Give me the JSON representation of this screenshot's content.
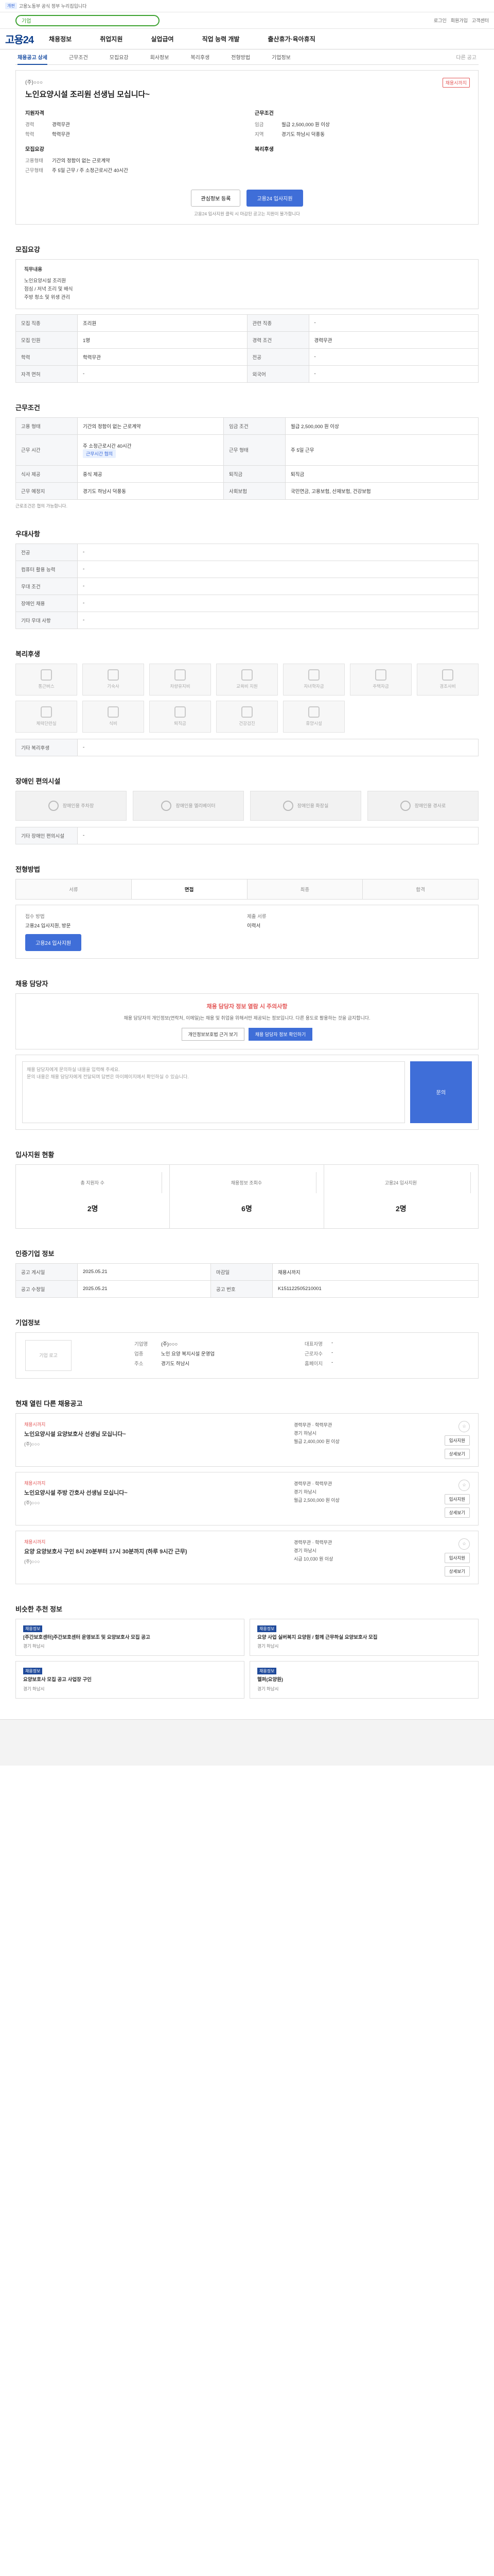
{
  "topbar": {
    "badge": "개편",
    "text": "고용노동부 공식 정부 누리집입니다"
  },
  "search": {
    "placeholder": "기업"
  },
  "util": [
    "로그인",
    "회원가입",
    "고객센터"
  ],
  "gnb": {
    "logo": "고용24",
    "menu": [
      "채용정보",
      "취업지원",
      "실업급여",
      "직업 능력 개발",
      "출산휴가·육아휴직"
    ]
  },
  "tabs": {
    "items": [
      "채용공고 상세",
      "근무조건",
      "모집요강",
      "회사정보",
      "복리후생",
      "전형방법",
      "기업정보"
    ],
    "right": "다른 공고"
  },
  "job": {
    "company": "(주)○○○",
    "title": "노인요양시설 조리원 선생님 모십니다~",
    "dday": "채용시까지",
    "left_title": "지원자격",
    "left": [
      {
        "k": "경력",
        "v": "경력무관"
      },
      {
        "k": "학력",
        "v": "학력무관"
      }
    ],
    "right_title": "근무조건",
    "right": [
      {
        "k": "임금",
        "v": "월급 2,500,000 원 이상"
      },
      {
        "k": "지역",
        "v": "경기도 하남시 덕풍동"
      }
    ],
    "left2_title": "모집요강",
    "left2": [
      {
        "k": "고용형태",
        "v": "기간의 정함이 없는 근로계약"
      },
      {
        "k": "근무형태",
        "v": "주 5일 근무 / 주 소정근로시간 40시간"
      }
    ],
    "right2_title": "복리후생",
    "right2": [
      {
        "k": "",
        "v": ""
      }
    ],
    "btn_scrap": "관심정보 등록",
    "btn_apply": "고용24 입사지원",
    "notice": "고용24 입사지원 클릭 시 마감된 공고는 지원이 불가합니다"
  },
  "sections": {
    "recruit": "모집요강",
    "work": "근무조건",
    "pref": "우대사항",
    "benefit": "복리후생",
    "disabled": "장애인 편의시설",
    "process": "전형방법",
    "contact": "채용 담당자",
    "status": "입사지원 현황",
    "info": "인증기업 정보",
    "company": "기업정보",
    "similar": "현재 열린 다른 채용공고",
    "recommend": "비슷한 추천 정보"
  },
  "recruit": {
    "duty_label": "직무내용",
    "duty_text": "노인요양시설 조리원\n점심 / 저녁 조리 및 배식\n주방 청소 및 위생 관리",
    "rows": [
      [
        "모집 직종",
        "조리원",
        "관련 직종",
        "-"
      ],
      [
        "모집 인원",
        "1명",
        "경력 조건",
        "경력무관"
      ],
      [
        "학력",
        "학력무관",
        "전공",
        "-"
      ],
      [
        "자격 면허",
        "-",
        "외국어",
        "-"
      ]
    ]
  },
  "work": {
    "rows": [
      [
        "고용 형태",
        "기간의 정함이 없는 근로계약",
        "임금 조건",
        "월급 2,500,000 원 이상"
      ],
      [
        "근무 시간",
        "주 소정근로시간 40시간",
        "근무 형태",
        "주 5일 근무"
      ],
      [
        "식사 제공",
        "중식 제공",
        "퇴직금",
        "퇴직금"
      ],
      [
        "근무 예정지",
        "경기도 하남시 덕풍동",
        "사회보험",
        "국민연금, 고용보험, 산재보험, 건강보험"
      ]
    ],
    "tag": "근무시간 협의",
    "note": "근로조건은 협의 가능합니다."
  },
  "pref": {
    "rows": [
      [
        "전공",
        "-"
      ],
      [
        "컴퓨터 활용 능력",
        "-"
      ],
      [
        "우대 조건",
        "-"
      ],
      [
        "장애인 채용",
        "-"
      ],
      [
        "기타 우대 사항",
        "-"
      ]
    ]
  },
  "benefit": {
    "label": "기타 복리후생",
    "items": [
      "통근버스",
      "기숙사",
      "차량유지비",
      "교육비 지원",
      "자녀학자금",
      "주택자금",
      "경조사비",
      "체력단련실",
      "식비",
      "퇴직금",
      "건강검진",
      "휴양시설"
    ]
  },
  "disabled": {
    "items": [
      "장애인용 주차장",
      "장애인용 엘리베이터",
      "장애인용 화장실",
      "장애인용 경사로"
    ],
    "label": "기타 장애인 편의시설"
  },
  "process": {
    "steps": [
      "서류",
      "면접",
      "최종",
      "합격"
    ],
    "how_label": "접수 방법",
    "how_value": "고용24 입사지원, 방문",
    "doc_label": "제출 서류",
    "doc_value": "이력서",
    "apply": "고용24 입사지원"
  },
  "contact": {
    "warn_title": "채용 담당자 정보 열람 시 주의사항",
    "warn_desc": "채용 담당자의 개인정보(연락처, 이메일)는 채용 및 취업을 위해서만 제공되는 정보입니다. 다른 용도로 활용하는 것을 금지합니다.",
    "btn1": "개인정보보호법 근거 보기",
    "btn2": "채용 담당자 정보 확인하기",
    "inq_placeholder": "채용 담당자에게 문의하실 내용을 입력해 주세요.\n문의 내용은 채용 담당자에게 전달되며 답변은 마이페이지에서 확인하실 수 있습니다.",
    "send": "문의"
  },
  "status": {
    "stats": [
      {
        "lab": "총 지원자 수",
        "num": "2명"
      },
      {
        "lab": "채용정보 조회수",
        "num": "6명"
      },
      {
        "lab": "고용24 입사지원",
        "num": "2명"
      }
    ]
  },
  "info": {
    "rows": [
      [
        "공고 게시일",
        "2025.05.21",
        "마감일",
        "채용시까지"
      ],
      [
        "공고 수정일",
        "2025.05.21",
        "공고 번호",
        "K151122505210001"
      ]
    ]
  },
  "company": {
    "logo": "기업 로고",
    "kv": [
      {
        "k": "기업명",
        "v": "(주)○○○"
      },
      {
        "k": "업종",
        "v": "노인 요양 복지시설 운영업"
      },
      {
        "k": "주소",
        "v": "경기도 하남시"
      }
    ],
    "kv2": [
      {
        "k": "대표자명",
        "v": "-"
      },
      {
        "k": "근로자수",
        "v": "-"
      },
      {
        "k": "홈페이지",
        "v": "-"
      }
    ]
  },
  "similar": [
    {
      "dday": "채용시까지",
      "title": "노인요양시설 요양보호사 선생님 모십니다~",
      "co": "(주)○○○",
      "meta": [
        "경력무관 · 학력무관",
        "경기 하남시",
        "월급 2,400,000 원 이상"
      ]
    },
    {
      "dday": "채용시까지",
      "title": "노인요양시설 주방 간호사 선생님 모십니다~",
      "co": "(주)○○○",
      "meta": [
        "경력무관 · 학력무관",
        "경기 하남시",
        "월급 2,500,000 원 이상"
      ]
    },
    {
      "dday": "채용시까지",
      "title": "요양 요양보호사 구인 8시 20분부터 17시 30분까지 (하루 9시간 근무)",
      "co": "(주)○○○",
      "meta": [
        "경력무관 · 학력무관",
        "경기 하남시",
        "시급 10,030 원 이상"
      ]
    }
  ],
  "similar_actions": {
    "scrap": "☆",
    "a1": "입사지원",
    "a2": "상세보기"
  },
  "recommend": [
    {
      "b": "채용정보",
      "t": "[주간보호센터]주간보호센터 운영보조 및 요양보호사 모집 공고",
      "c": "경기 하남시"
    },
    {
      "b": "채용정보",
      "t": "요양 사업 실버복지 요양원 / 함께 근무하실 요양보호사 모집",
      "c": "경기 하남시"
    },
    {
      "b": "채용정보",
      "t": "요양보호사 모집 공고 사업장 구인",
      "c": "경기 하남시"
    },
    {
      "b": "채용정보",
      "t": "헬퍼(요양원)",
      "c": "경기 하남시"
    }
  ]
}
